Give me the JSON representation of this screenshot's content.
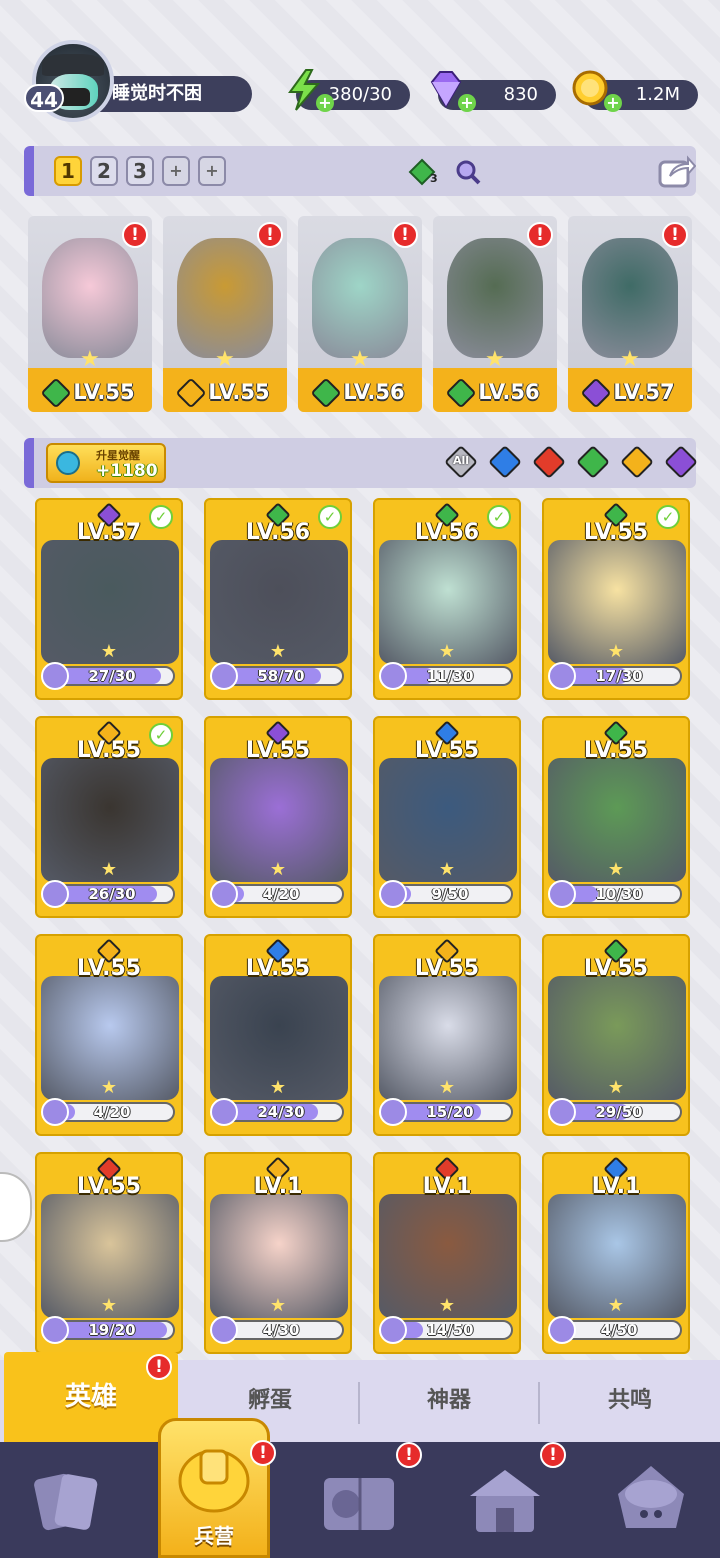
{
  "player": {
    "level": "44",
    "name": "睡觉时不困"
  },
  "resources": {
    "energy": "380/30",
    "gems": "830",
    "coins": "1.2M"
  },
  "team_slots": [
    "1",
    "2",
    "3",
    "+",
    "+"
  ],
  "team_gem_count": "3",
  "team": [
    {
      "level": "LV.55",
      "element": "#3fb64a",
      "art": "#f6c9d8",
      "alert": true
    },
    {
      "level": "LV.55",
      "element": "#f4b21b",
      "art": "#c99a34",
      "alert": true
    },
    {
      "level": "LV.56",
      "element": "#3fb64a",
      "art": "#9ed5c7",
      "alert": true
    },
    {
      "level": "LV.56",
      "element": "#3fb64a",
      "art": "#556c53",
      "alert": true
    },
    {
      "level": "LV.57",
      "element": "#8b4fd6",
      "art": "#3f6b66",
      "alert": true
    }
  ],
  "upgrade": {
    "title": "升星觉醒",
    "value": "+1180"
  },
  "filters": [
    {
      "label": "All",
      "color": "#b9b9c2"
    },
    {
      "label": "",
      "color": "#2f7ee6"
    },
    {
      "label": "",
      "color": "#e23c2a"
    },
    {
      "label": "",
      "color": "#3fb64a"
    },
    {
      "label": "",
      "color": "#f4b21b"
    },
    {
      "label": "",
      "color": "#8b4fd6"
    }
  ],
  "heroes": [
    {
      "level": "LV.57",
      "element": "#8b4fd6",
      "check": true,
      "progress": "27/30",
      "fill": 0.9,
      "art": "#4a5a5e"
    },
    {
      "level": "LV.56",
      "element": "#3fb64a",
      "check": true,
      "progress": "58/70",
      "fill": 0.83,
      "art": "#4d4f5a"
    },
    {
      "level": "LV.56",
      "element": "#3fb64a",
      "check": true,
      "progress": "11/30",
      "fill": 0.37,
      "art": "#bfe0d2"
    },
    {
      "level": "LV.55",
      "element": "#3fb64a",
      "check": true,
      "progress": "17/30",
      "fill": 0.57,
      "art": "#f7e2a2"
    },
    {
      "level": "LV.55",
      "element": "#f4b21b",
      "check": true,
      "progress": "26/30",
      "fill": 0.87,
      "art": "#3a3530"
    },
    {
      "level": "LV.55",
      "element": "#8b4fd6",
      "check": false,
      "progress": "4/20",
      "fill": 0.2,
      "art": "#9b6fd6"
    },
    {
      "level": "LV.55",
      "element": "#2f7ee6",
      "check": false,
      "progress": "9/50",
      "fill": 0.18,
      "art": "#3c5a7e"
    },
    {
      "level": "LV.55",
      "element": "#3fb64a",
      "check": false,
      "progress": "10/30",
      "fill": 0.33,
      "art": "#5d9a56"
    },
    {
      "level": "LV.55",
      "element": "#f4b21b",
      "check": false,
      "progress": "4/20",
      "fill": 0.2,
      "art": "#b8c9ee"
    },
    {
      "level": "LV.55",
      "element": "#2f7ee6",
      "check": false,
      "progress": "24/30",
      "fill": 0.8,
      "art": "#3a4350"
    },
    {
      "level": "LV.55",
      "element": "#f4b21b",
      "check": false,
      "progress": "15/20",
      "fill": 0.75,
      "art": "#d9dce8"
    },
    {
      "level": "LV.55",
      "element": "#3fb64a",
      "check": false,
      "progress": "29/50",
      "fill": 0.58,
      "art": "#7a9a5a"
    },
    {
      "level": "LV.55",
      "element": "#e23c2a",
      "check": false,
      "progress": "19/20",
      "fill": 0.95,
      "art": "#d9c49a"
    },
    {
      "level": "LV.1",
      "element": "#f4b21b",
      "check": false,
      "progress": "4/30",
      "fill": 0.13,
      "art": "#f6d3c9"
    },
    {
      "level": "LV.1",
      "element": "#e23c2a",
      "check": false,
      "progress": "14/50",
      "fill": 0.28,
      "art": "#8a5a40"
    },
    {
      "level": "LV.1",
      "element": "#2f7ee6",
      "check": false,
      "progress": "4/50",
      "fill": 0.08,
      "art": "#a9c6e6"
    }
  ],
  "subtabs": [
    "英雄",
    "孵蛋",
    "神器",
    "共鸣"
  ],
  "nav": {
    "barracks_label": "兵营"
  }
}
